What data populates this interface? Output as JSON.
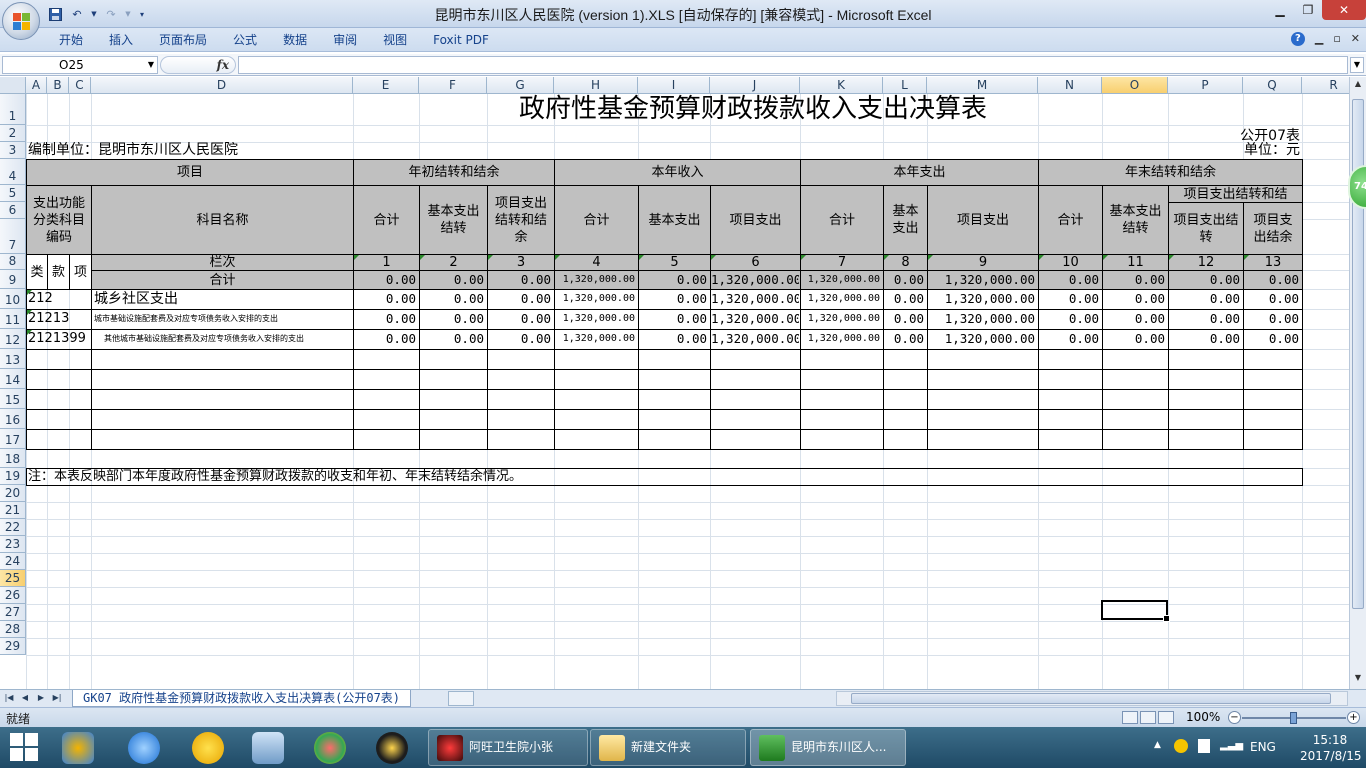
{
  "window": {
    "title": "昆明市东川区人民医院 (version 1).XLS [自动保存的]  [兼容模式] - Microsoft Excel",
    "min_icon": "minimize-icon",
    "restore_icon": "restore-icon",
    "close_icon": "close-icon"
  },
  "ribbon": {
    "tabs": [
      "开始",
      "插入",
      "页面布局",
      "公式",
      "数据",
      "审阅",
      "视图",
      "Foxit PDF"
    ]
  },
  "formula_bar": {
    "name_box": "O25",
    "fx_label": "fx",
    "content": ""
  },
  "columns": [
    "A",
    "B",
    "C",
    "D",
    "E",
    "F",
    "G",
    "H",
    "I",
    "J",
    "K",
    "L",
    "M",
    "N",
    "O",
    "P",
    "Q",
    "R"
  ],
  "rows": [
    "1",
    "2",
    "3",
    "4",
    "5",
    "6",
    "7",
    "8",
    "9",
    "10",
    "11",
    "12",
    "13",
    "14",
    "15",
    "16",
    "17",
    "18",
    "19",
    "20",
    "21",
    "22",
    "23",
    "24",
    "25",
    "26",
    "27",
    "28",
    "29"
  ],
  "sheet": {
    "title": "政府性基金预算财政拨款收入支出决算表",
    "form_code": "公开07表",
    "org_label": "编制单位：昆明市东川区人民医院",
    "unit_label": "单位：元",
    "hdr_item": "项目",
    "hdr_begin": "年初结转和结余",
    "hdr_income": "本年收入",
    "hdr_expense": "本年支出",
    "hdr_end": "年末结转和结余",
    "hdr_code": "支出功能分类科目编码",
    "hdr_subject": "科目名称",
    "hdr_total": "合计",
    "hdr_basic_carry": "基本支出结转",
    "hdr_proj_carry": "项目支出结转和结余",
    "hdr_basic": "基本支出",
    "hdr_project": "项目支出",
    "hdr_basic_short": "基本支出",
    "hdr_end_proj": "项目支出结转和结",
    "hdr_end_proj_carry": "项目支出结转",
    "hdr_end_proj_surplus": "项目支出结余",
    "hdr_lei": "类",
    "hdr_kuan": "款",
    "hdr_xiang": "项",
    "hdr_lanci": "栏次",
    "col_nums": [
      "1",
      "2",
      "3",
      "4",
      "5",
      "6",
      "7",
      "8",
      "9",
      "10",
      "11",
      "12",
      "13"
    ],
    "data_rows": [
      {
        "code": "",
        "name": "合计",
        "vals": [
          "0.00",
          "0.00",
          "0.00",
          "1,320,000.00",
          "0.00",
          "1,320,000.00",
          "1,320,000.00",
          "0.00",
          "1,320,000.00",
          "0.00",
          "0.00",
          "0.00",
          "0.00"
        ]
      },
      {
        "code": "212",
        "name": "城乡社区支出",
        "vals": [
          "0.00",
          "0.00",
          "0.00",
          "1,320,000.00",
          "0.00",
          "1,320,000.00",
          "1,320,000.00",
          "0.00",
          "1,320,000.00",
          "0.00",
          "0.00",
          "0.00",
          "0.00"
        ]
      },
      {
        "code": "21213",
        "name": "城市基础设施配套费及对应专项债务收入安排的支出",
        "vals": [
          "0.00",
          "0.00",
          "0.00",
          "1,320,000.00",
          "0.00",
          "1,320,000.00",
          "1,320,000.00",
          "0.00",
          "1,320,000.00",
          "0.00",
          "0.00",
          "0.00",
          "0.00"
        ]
      },
      {
        "code": "2121399",
        "name": "其他城市基础设施配套费及对应专项债务收入安排的支出",
        "vals": [
          "0.00",
          "0.00",
          "0.00",
          "1,320,000.00",
          "0.00",
          "1,320,000.00",
          "1,320,000.00",
          "0.00",
          "1,320,000.00",
          "0.00",
          "0.00",
          "0.00",
          "0.00"
        ]
      }
    ],
    "note": "注：本表反映部门本年度政府性基金预算财政拨款的收支和年初、年末结转结余情况。"
  },
  "side_badge": "74",
  "sheet_tab": "GK07 政府性基金预算财政拨款收入支出决算表(公开07表)",
  "status": {
    "ready": "就绪",
    "zoom": "100%"
  },
  "taskbar": {
    "tasks": [
      "阿旺卫生院小张",
      "新建文件夹",
      "昆明市东川区人..."
    ],
    "ime": "ENG",
    "time": "15:18",
    "date": "2017/8/15"
  }
}
